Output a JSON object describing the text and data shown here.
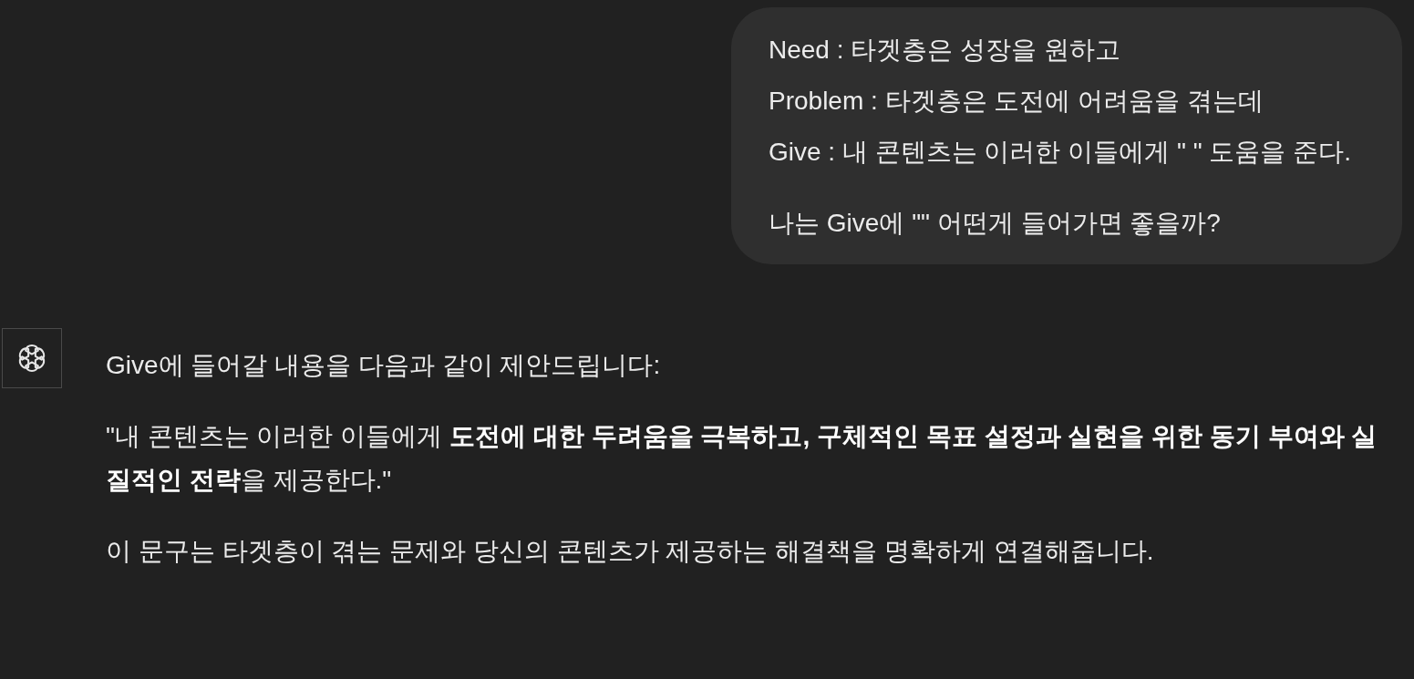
{
  "user_message": {
    "paragraphs": [
      [
        "Need : 타겟층은 성장을 원하고",
        "Problem : 타겟층은 도전에 어려움을 겪는데",
        "Give : 내 콘텐츠는 이러한 이들에게 \" \" 도움을 준다."
      ],
      [
        "나는 Give에 \"\" 어떤게 들어가면 좋을까?"
      ]
    ]
  },
  "assistant_message": {
    "paragraphs": [
      "Give에 들어갈 내용을 다음과 같이 제안드립니다:",
      "\"내 콘텐츠는 이러한 이들에게 **도전에 대한 두려움을 극복하고, 구체적인 목표 설정과 실현을 위한 동기 부여와 실질적인 전략**을 제공한다.\"",
      "이 문구는 타겟층이 겪는 문제와 당신의 콘텐츠가 제공하는 해결책을 명확하게 연결해줍니다."
    ]
  }
}
